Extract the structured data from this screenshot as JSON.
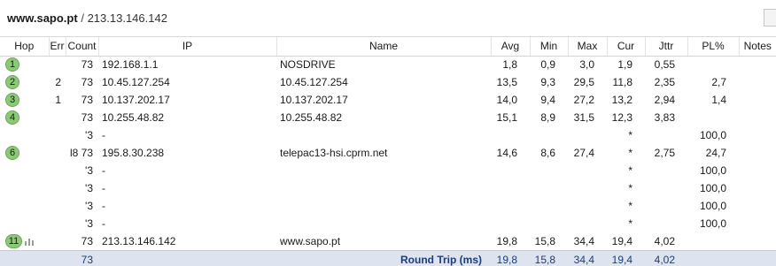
{
  "window": {
    "host": "www.sapo.pt",
    "separator": "/",
    "ip": "213.13.146.142"
  },
  "columns": {
    "hop": "Hop",
    "err": "Err",
    "count": "Count",
    "ip": "IP",
    "name": "Name",
    "avg": "Avg",
    "min": "Min",
    "max": "Max",
    "cur": "Cur",
    "jttr": "Jttr",
    "pl": "PL%",
    "notes": "Notes"
  },
  "rows": [
    {
      "hop": "1",
      "err": "",
      "count": "73",
      "ip": "192.168.1.1",
      "name": "NOSDRIVE",
      "avg": "1,8",
      "min": "0,9",
      "max": "3,0",
      "cur": "1,9",
      "jttr": "0,55",
      "pl": "",
      "notes": ""
    },
    {
      "hop": "2",
      "err": "2",
      "count": "73",
      "ip": "10.45.127.254",
      "name": "10.45.127.254",
      "avg": "13,5",
      "min": "9,3",
      "max": "29,5",
      "cur": "11,8",
      "jttr": "2,35",
      "pl": "2,7",
      "notes": ""
    },
    {
      "hop": "3",
      "err": "1",
      "count": "73",
      "ip": "10.137.202.17",
      "name": "10.137.202.17",
      "avg": "14,0",
      "min": "9,4",
      "max": "27,2",
      "cur": "13,2",
      "jttr": "2,94",
      "pl": "1,4",
      "notes": ""
    },
    {
      "hop": "4",
      "err": "",
      "count": "73",
      "ip": "10.255.48.82",
      "name": "10.255.48.82",
      "avg": "15,1",
      "min": "8,9",
      "max": "31,5",
      "cur": "12,3",
      "jttr": "3,83",
      "pl": "",
      "notes": ""
    },
    {
      "hop": "",
      "err": "",
      "count": "'3",
      "ip": "-",
      "name": "",
      "avg": "",
      "min": "",
      "max": "",
      "cur": "*",
      "jttr": "",
      "pl": "100,0",
      "notes": ""
    },
    {
      "hop": "6",
      "err": "",
      "count": "l8   73",
      "ip": "195.8.30.238",
      "name": "telepac13-hsi.cprm.net",
      "avg": "14,6",
      "min": "8,6",
      "max": "27,4",
      "cur": "*",
      "jttr": "2,75",
      "pl": "24,7",
      "notes": ""
    },
    {
      "hop": "",
      "err": "",
      "count": "'3",
      "ip": "-",
      "name": "",
      "avg": "",
      "min": "",
      "max": "",
      "cur": "*",
      "jttr": "",
      "pl": "100,0",
      "notes": ""
    },
    {
      "hop": "",
      "err": "",
      "count": "'3",
      "ip": "-",
      "name": "",
      "avg": "",
      "min": "",
      "max": "",
      "cur": "*",
      "jttr": "",
      "pl": "100,0",
      "notes": ""
    },
    {
      "hop": "",
      "err": "",
      "count": "'3",
      "ip": "-",
      "name": "",
      "avg": "",
      "min": "",
      "max": "",
      "cur": "*",
      "jttr": "",
      "pl": "100,0",
      "notes": ""
    },
    {
      "hop": "",
      "err": "",
      "count": "'3",
      "ip": "-",
      "name": "",
      "avg": "",
      "min": "",
      "max": "",
      "cur": "*",
      "jttr": "",
      "pl": "100,0",
      "notes": ""
    },
    {
      "hop": "11",
      "err": "",
      "count": "73",
      "ip": "213.13.146.142",
      "name": "www.sapo.pt",
      "avg": "19,8",
      "min": "15,8",
      "max": "34,4",
      "cur": "19,4",
      "jttr": "4,02",
      "pl": "",
      "notes": "",
      "graph_icon": "bar-chart-icon"
    }
  ],
  "footer": {
    "count": "73",
    "label": "Round Trip (ms)",
    "avg": "19,8",
    "min": "15,8",
    "max": "34,4",
    "cur": "19,4",
    "jttr": "4,02"
  },
  "colors": {
    "hop_badge": "#8cc976",
    "footer_bg": "#dde3ef",
    "footer_text": "#1c3d7a"
  }
}
